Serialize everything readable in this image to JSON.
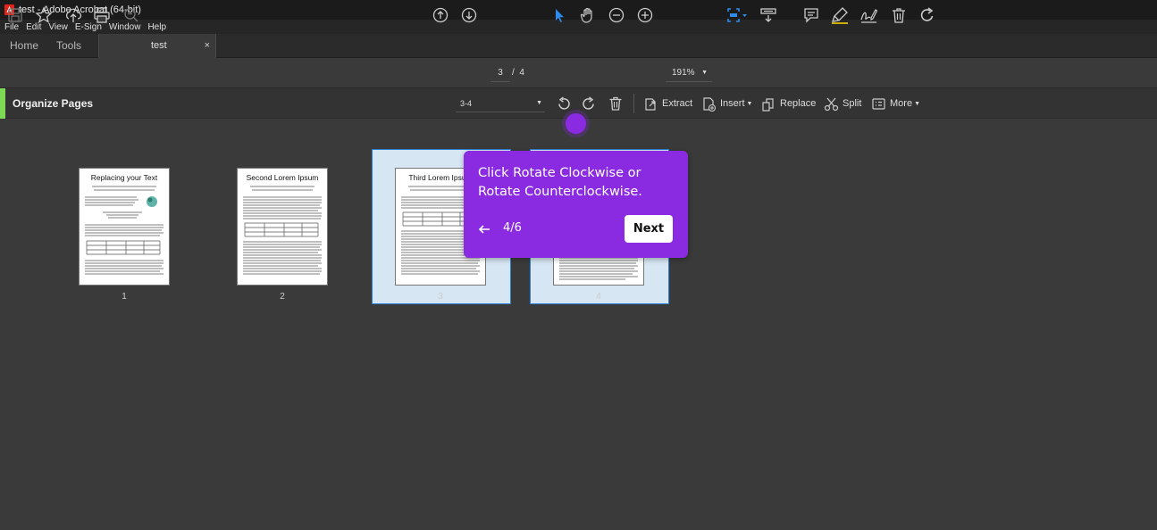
{
  "window": {
    "title": "test - Adobe Acrobat (64-bit)"
  },
  "menu": [
    "File",
    "Edit",
    "View",
    "E-Sign",
    "Window",
    "Help"
  ],
  "tabs": {
    "home": "Home",
    "tools": "Tools",
    "doc": "test",
    "close": "×"
  },
  "toolbar": {
    "page_current": "3",
    "page_sep": "/",
    "page_total": "4",
    "zoom": "191%"
  },
  "organize": {
    "title": "Organize Pages",
    "range": "3-4",
    "extract": "Extract",
    "insert": "Insert",
    "replace": "Replace",
    "split": "Split",
    "more": "More"
  },
  "pages": [
    {
      "number": "1",
      "heading": "Replacing your Text",
      "selected": false
    },
    {
      "number": "2",
      "heading": "Second Lorem Ipsum",
      "selected": false
    },
    {
      "number": "3",
      "heading": "Third Lorem Ipsum",
      "selected": true
    },
    {
      "number": "4",
      "heading": "",
      "selected": true
    }
  ],
  "tooltip": {
    "text": "Click Rotate Clockwise or Rotate Counterclockwise.",
    "step": "4/6",
    "next_label": "Next"
  },
  "colors": {
    "accent_green": "#7ed957",
    "tooltip_purple": "#8a2be2",
    "selection_blue": "#2a7fd4",
    "tool_blue": "#2d8ceb"
  },
  "icons": [
    "pdf-app-icon",
    "save-icon",
    "star-icon",
    "upload-cloud-icon",
    "print-icon",
    "zoom-search-icon",
    "arrow-up-circle-icon",
    "arrow-down-circle-icon",
    "cursor-icon",
    "hand-icon",
    "zoom-out-icon",
    "zoom-in-icon",
    "fit-page-icon",
    "scroll-mode-icon",
    "comment-icon",
    "highlight-icon",
    "sign-icon",
    "delete-icon",
    "rotate-icon"
  ]
}
